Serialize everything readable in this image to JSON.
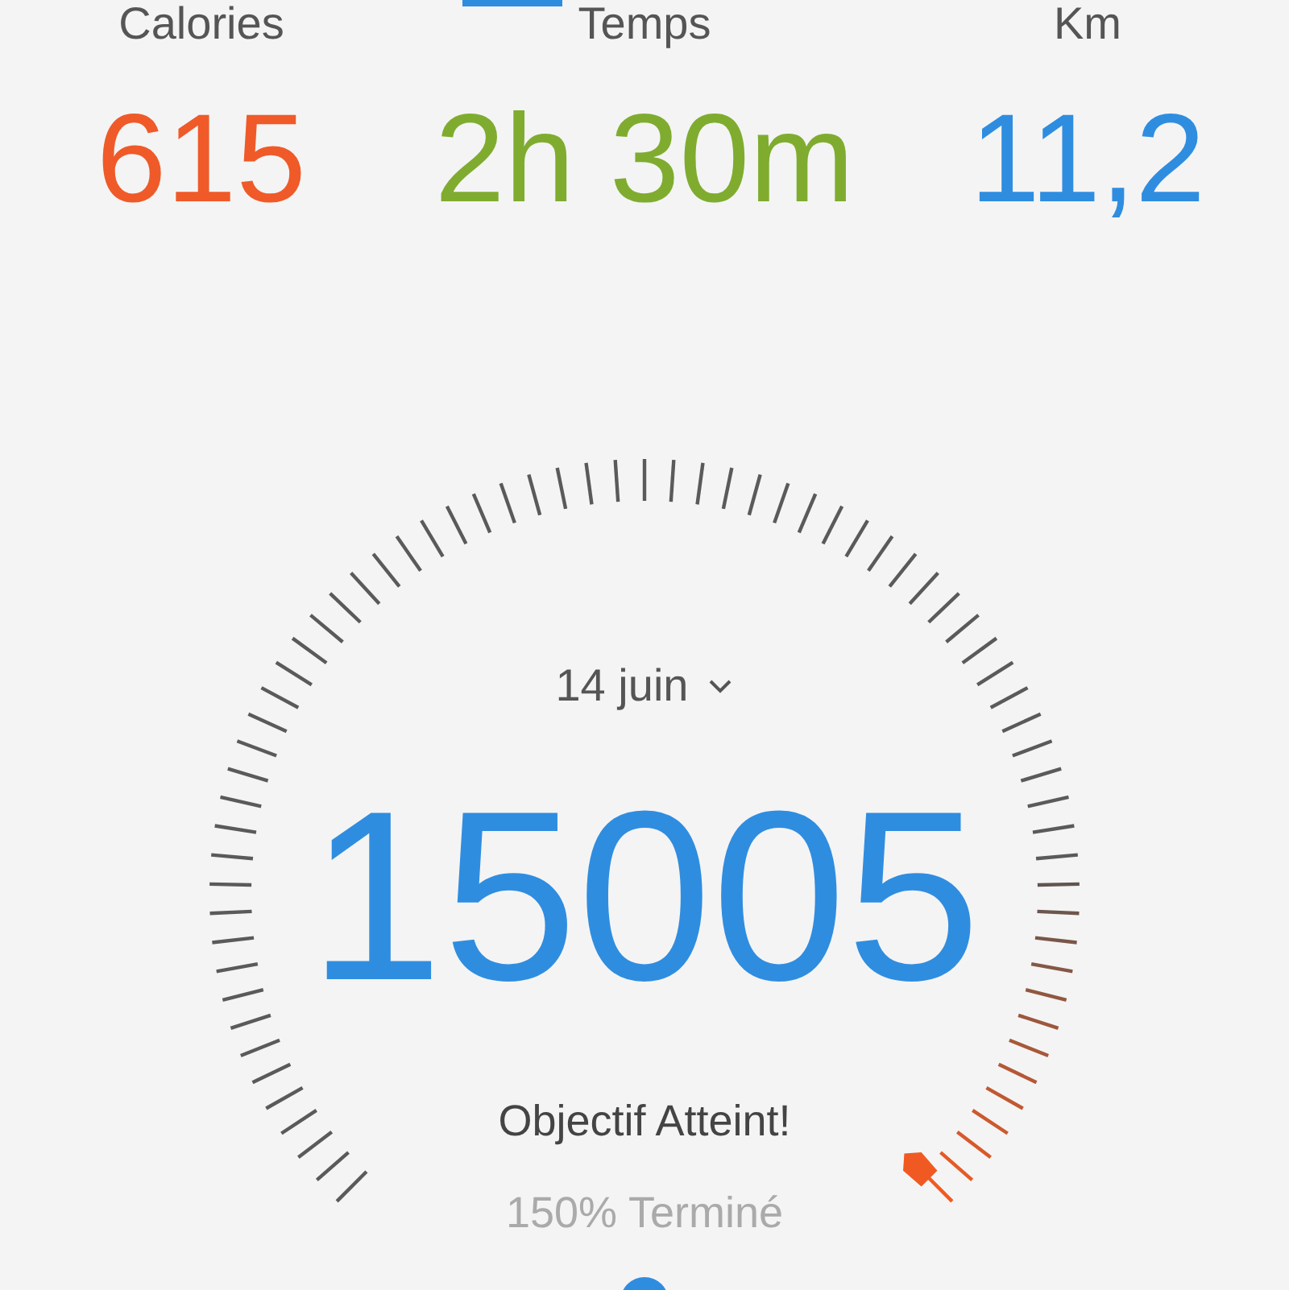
{
  "stats": [
    {
      "label": "Calories",
      "value": "615",
      "color": "#ef5a28"
    },
    {
      "label": "Temps",
      "value": "2h 30m",
      "color": "#7fac2f"
    },
    {
      "label": "Km",
      "value": "11,2",
      "color": "#2f8de0"
    }
  ],
  "gauge": {
    "date": "14 juin",
    "steps": "15005",
    "status": "Objectif Atteint!",
    "progress": "150% Terminé",
    "level": 1
  }
}
